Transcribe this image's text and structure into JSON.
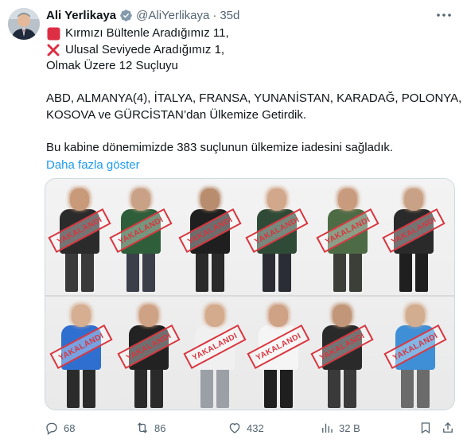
{
  "tweet": {
    "author_name": "Ali Yerlikaya",
    "handle": "@AliYerlikaya",
    "separator": "·",
    "time": "35d",
    "lines": [
      "Kırmızı Bültenle Aradığımız 11,",
      "Ulusal Seviyede Aradığımız 1,",
      "Olmak Üzere 12 Suçluyu"
    ],
    "countries": "ABD, ALMANYA(4), İTALYA, FRANSA, YUNANİSTAN, KARADAĞ, POLONYA,",
    "countries2": "KOSOVA ve GÜRCİSTAN’dan Ülkemize Getirdik.",
    "summary": "Bu kabine dönemimizde 383 suçlunun ülkemize iadesini sağladık.",
    "show_more": "Daha fazla göster"
  },
  "media": {
    "stamp_text": "YAKALANDI"
  },
  "actions": {
    "replies": "68",
    "reposts": "86",
    "likes": "432",
    "views": "32 B"
  },
  "icons": {
    "verified": "verified-badge-icon",
    "more": "more-dots-icon",
    "red_square": "red-square-emoji-icon",
    "cross": "cross-mark-emoji-icon",
    "reply": "reply-icon",
    "repost": "repost-icon",
    "like": "heart-icon",
    "views": "views-chart-icon",
    "bookmark": "bookmark-icon",
    "share": "share-icon"
  },
  "colors": {
    "link": "#1d9bf0",
    "muted": "#536471",
    "stamp_red": "#d9353e"
  }
}
